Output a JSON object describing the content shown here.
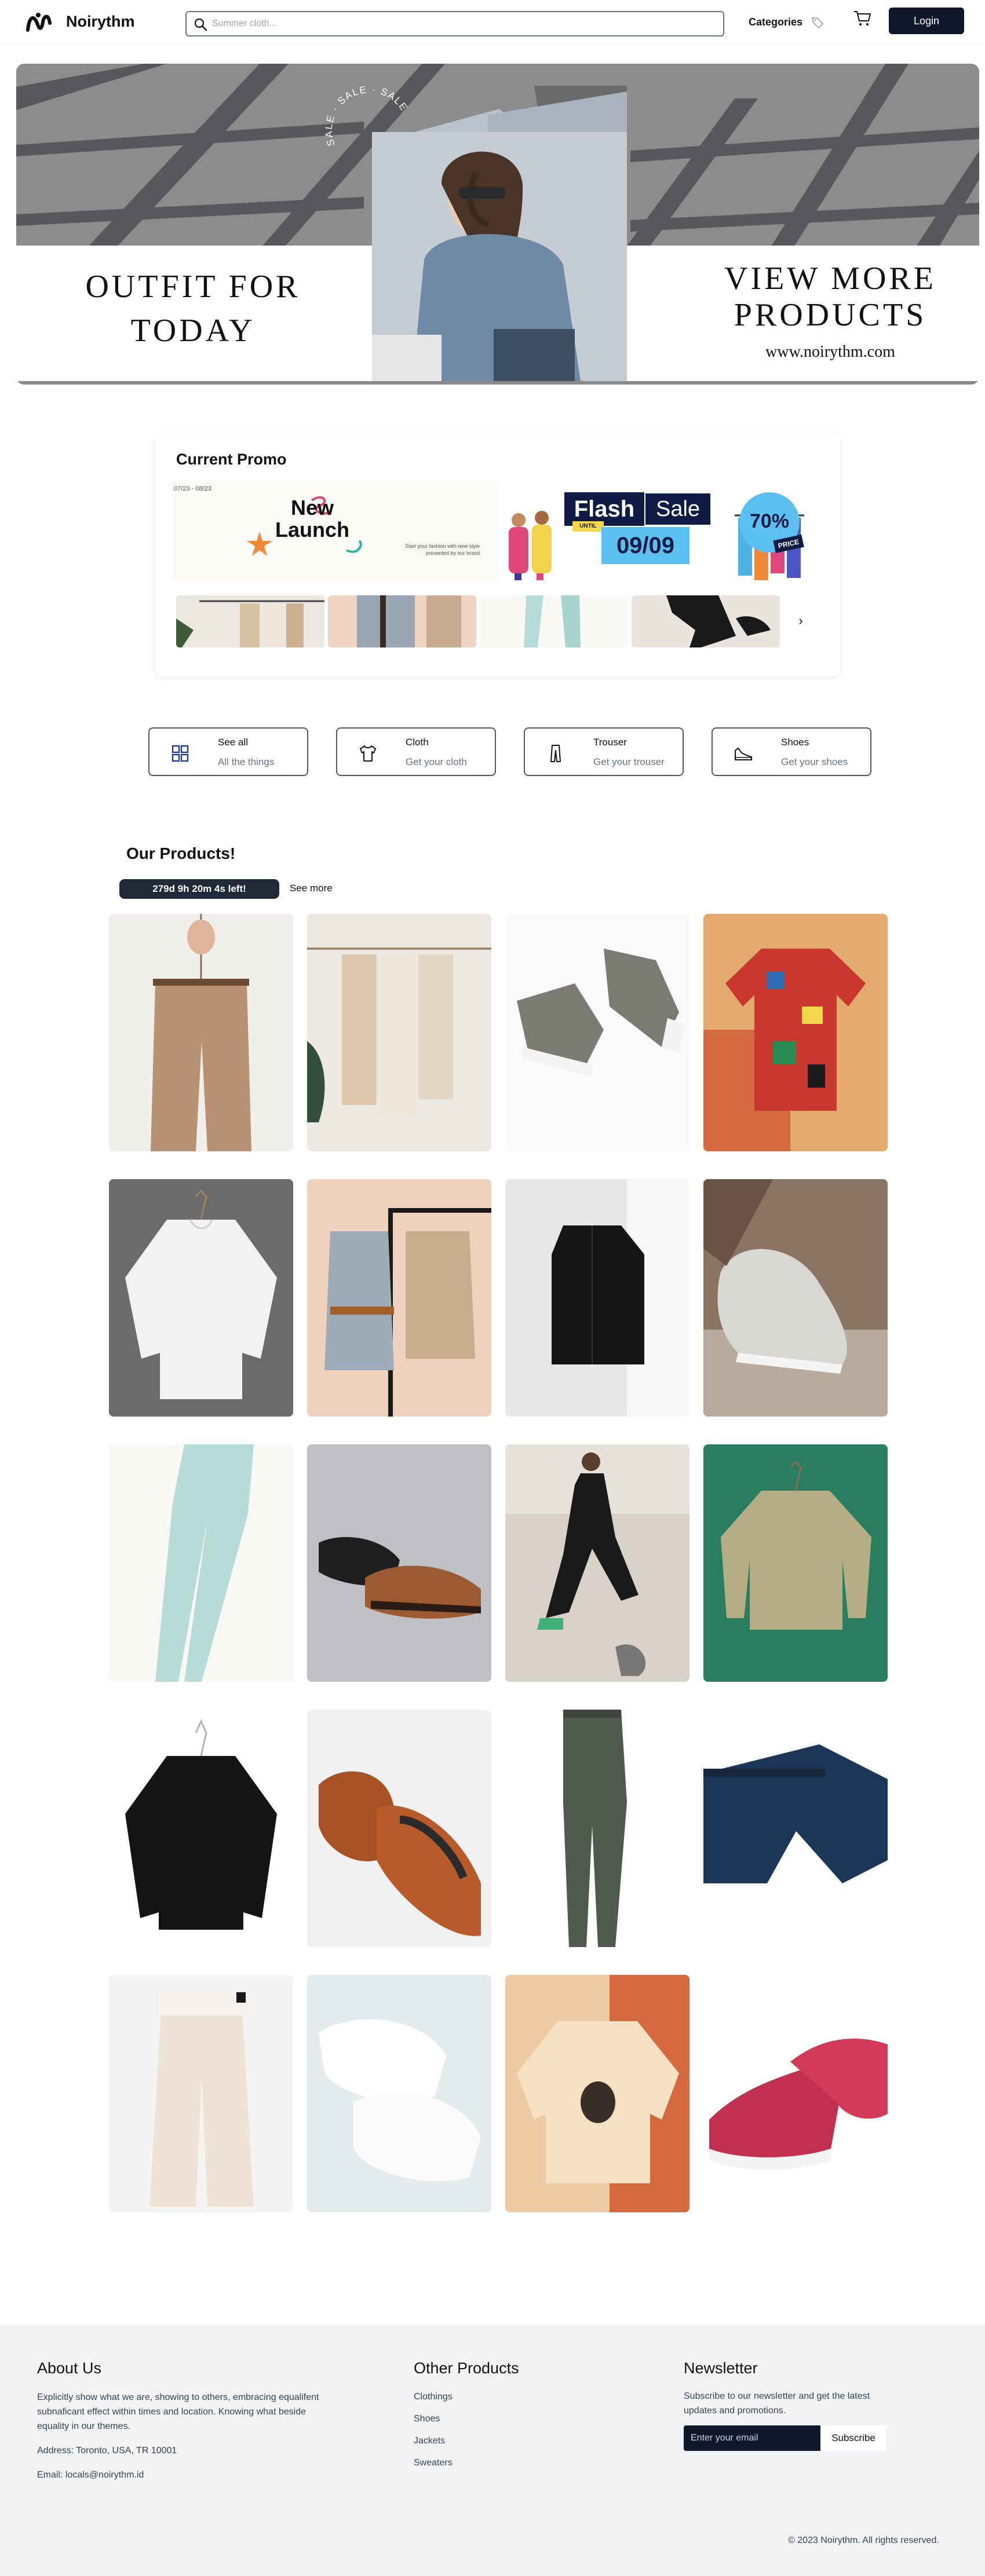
{
  "brand": {
    "name": "Noirythm"
  },
  "nav": {
    "search_placeholder": "Summer cloth...",
    "categories_label": "Categories",
    "login_label": "Login"
  },
  "hero": {
    "left_text": "OUTFIT FOR TODAY",
    "right_text": "VIEW MORE PRODUCTS",
    "url": "www.noirythm.com",
    "sale_arc_text": "SALE · SALE · SALE"
  },
  "promo": {
    "title": "Current Promo",
    "date": "07/23 - 08/23",
    "new_launch": "New Launch",
    "tagline": "Start your fashion with new style presented by our brand",
    "flash": "Flash",
    "sale": "Sale",
    "until": "UNTIL",
    "flash_date": "09/09",
    "percent": "70%",
    "price": "PRICE",
    "next_glyph": "›"
  },
  "categories": [
    {
      "title": "See all",
      "subtitle": "All the things",
      "icon": "grid-icon"
    },
    {
      "title": "Cloth",
      "subtitle": "Get your cloth",
      "icon": "shirt-icon"
    },
    {
      "title": "Trouser",
      "subtitle": "Get your trouser",
      "icon": "trouser-icon"
    },
    {
      "title": "Shoes",
      "subtitle": "Get your shoes",
      "icon": "shoe-icon"
    }
  ],
  "products": {
    "title": "Our Products!",
    "timer": "279d 9h 20m 4s  left!",
    "see_more": "See more"
  },
  "footer": {
    "about": {
      "title": "About Us",
      "text": "Explicitly show what we are, showing to others, embracing equalifent subnaficant effect within times and location. Knowing what beside equality in our themes.",
      "address": "Address: Toronto, USA, TR 10001",
      "email": "Email: locals@noirythm.id"
    },
    "other": {
      "title": "Other Products",
      "links": [
        "Clothings",
        "Shoes",
        "Jackets",
        "Sweaters"
      ]
    },
    "newsletter": {
      "title": "Newsletter",
      "text": "Subscribe to our newsletter and get the latest updates and promotions.",
      "placeholder": "Enter your email",
      "button": "Subscribe"
    },
    "copyright": "© 2023 Noirythm. All rights reserved."
  }
}
